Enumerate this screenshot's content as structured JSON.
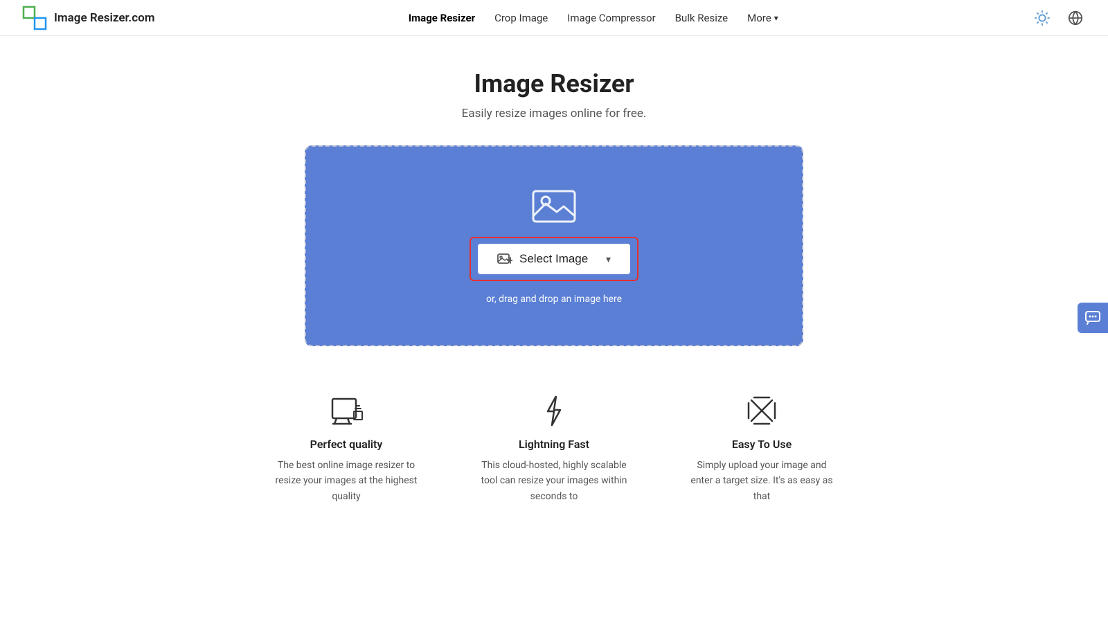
{
  "brand": {
    "name": "Image Resizer.com"
  },
  "nav": {
    "links": [
      {
        "id": "image-resizer",
        "label": "Image Resizer",
        "active": true
      },
      {
        "id": "crop-image",
        "label": "Crop Image",
        "active": false
      },
      {
        "id": "image-compressor",
        "label": "Image Compressor",
        "active": false
      },
      {
        "id": "bulk-resize",
        "label": "Bulk Resize",
        "active": false
      },
      {
        "id": "more",
        "label": "More",
        "active": false
      }
    ],
    "sun_icon": "☀",
    "globe_icon": "🌐"
  },
  "hero": {
    "title": "Image Resizer",
    "subtitle": "Easily resize images online for free."
  },
  "upload": {
    "button_label": "Select Image",
    "drag_drop_text": "or, drag and drop an image here"
  },
  "features": [
    {
      "id": "perfect-quality",
      "title": "Perfect quality",
      "description": "The best online image resizer to resize your images at the highest quality"
    },
    {
      "id": "lightning-fast",
      "title": "Lightning Fast",
      "description": "This cloud-hosted, highly scalable tool can resize your images within seconds to"
    },
    {
      "id": "easy-to-use",
      "title": "Easy To Use",
      "description": "Simply upload your image and enter a target size. It's as easy as that"
    }
  ]
}
